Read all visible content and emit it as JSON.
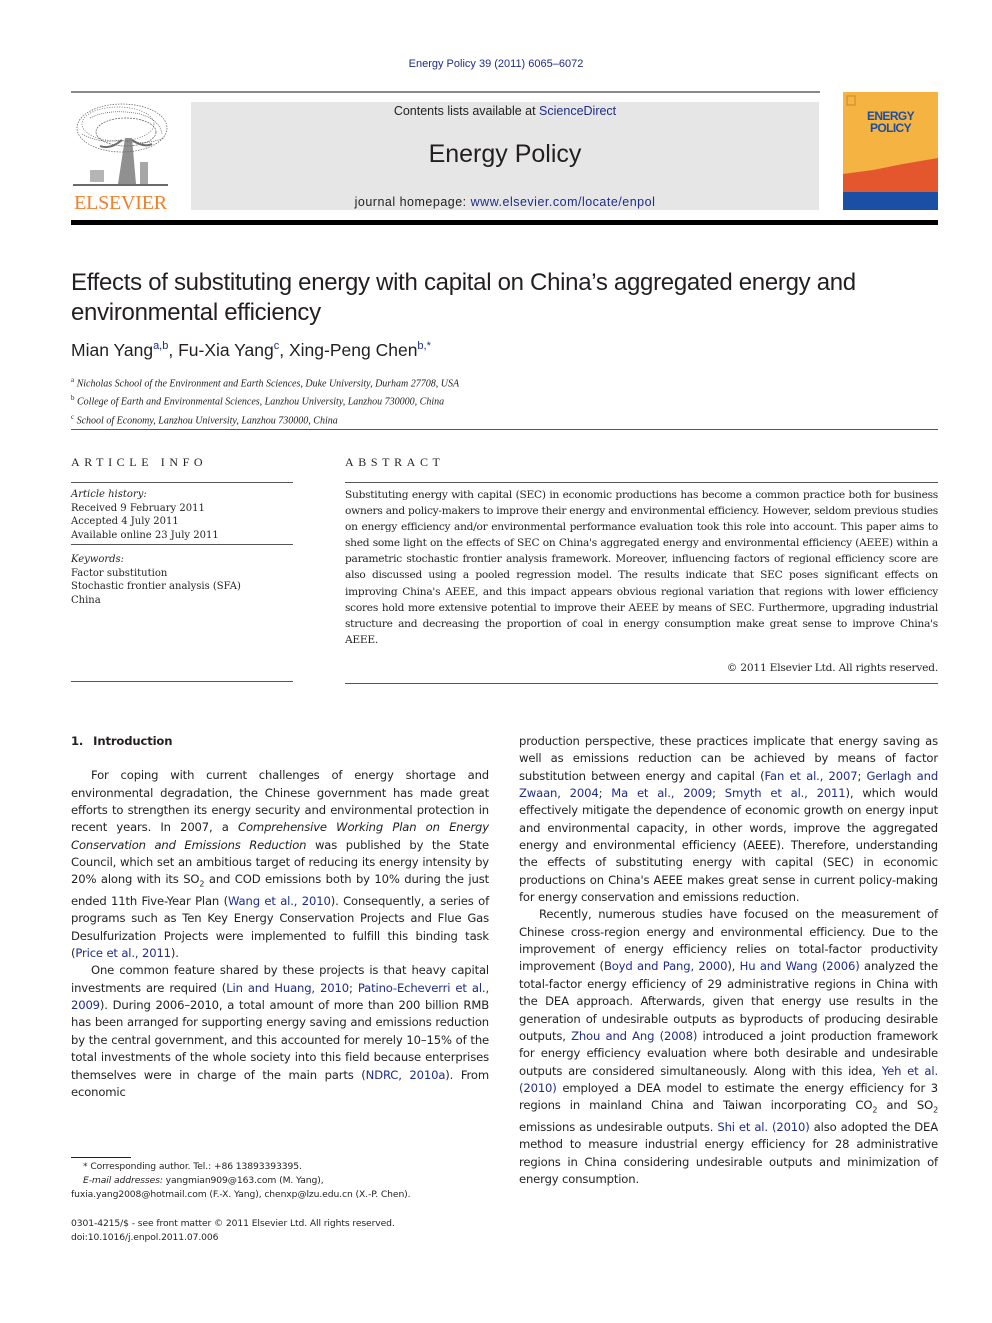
{
  "header": {
    "citation": "Energy Policy 39 (2011) 6065–6072",
    "contents_prefix": "Contents lists available at ",
    "contents_link": "ScienceDirect",
    "journal_name": "Energy Policy",
    "homepage_prefix": "journal homepage: ",
    "homepage_link": "www.elsevier.com/locate/enpol",
    "publisher_logo": "ELSEVIER",
    "cover_title_line1": "ENERGY",
    "cover_title_line2": "POLICY",
    "colors": {
      "link": "#1f2d86",
      "elsevier_orange": "#f0802b",
      "masthead_gray": "#e6e6e6",
      "cover_yellow": "#f5b342",
      "cover_orange": "#e4572e",
      "cover_blue": "#1b4fa6"
    }
  },
  "article": {
    "title": "Effects of substituting energy with capital on China’s aggregated energy and environmental efficiency",
    "authors": [
      {
        "name": "Mian Yang",
        "sup": "a,b"
      },
      {
        "name": "Fu-Xia Yang",
        "sup": "c"
      },
      {
        "name": "Xing-Peng Chen",
        "sup": "b,*"
      }
    ],
    "affiliations": [
      {
        "mark": "a",
        "text": "Nicholas School of the Environment and Earth Sciences, Duke University, Durham 27708, USA"
      },
      {
        "mark": "b",
        "text": "College of Earth and Environmental Sciences, Lanzhou University, Lanzhou 730000, China"
      },
      {
        "mark": "c",
        "text": "School of Economy, Lanzhou University, Lanzhou 730000, China"
      }
    ]
  },
  "article_info": {
    "heading": "ARTICLE INFO",
    "history_label": "Article history:",
    "history": [
      "Received 9 February 2011",
      "Accepted 4 July 2011",
      "Available online 23 July 2011"
    ],
    "keywords_label": "Keywords:",
    "keywords": [
      "Factor substitution",
      "Stochastic frontier analysis (SFA)",
      "China"
    ]
  },
  "abstract": {
    "heading": "ABSTRACT",
    "text": "Substituting energy with capital (SEC) in economic productions has become a common practice both for business owners and policy-makers to improve their energy and environmental efficiency. However, seldom previous studies on energy efficiency and/or environmental performance evaluation took this role into account. This paper aims to shed some light on the effects of SEC on China's aggregated energy and environmental efficiency (AEEE) within a parametric stochastic frontier analysis framework. Moreover, influencing factors of regional efficiency score are also discussed using a pooled regression model. The results indicate that SEC poses significant effects on improving China's AEEE, and this impact appears obvious regional variation that regions with lower efficiency scores hold more extensive potential to improve their AEEE by means of SEC. Furthermore, upgrading industrial structure and decreasing the proportion of coal in energy consumption make great sense to improve China's AEEE.",
    "copyright": "© 2011 Elsevier Ltd. All rights reserved."
  },
  "body": {
    "section_number": "1.",
    "section_title": "Introduction",
    "p1": {
      "t1": "For coping with current challenges of energy shortage and environmental degradation, the Chinese government has made great efforts to strengthen its energy security and environmental protection in recent years. In 2007, a ",
      "italic": "Comprehensive Working Plan on Energy Conservation and Emissions Reduction",
      "t2": " was published by the State Council, which set an ambitious target of reducing its energy intensity by 20% along with its SO",
      "sub1": "2",
      "t3": " and COD emissions both by 10% during the just ended 11th Five-Year Plan (",
      "ref1": "Wang et al., 2010",
      "t4": "). Consequently, a series of programs such as Ten Key Energy Conservation Projects and Flue Gas Desulfurization Projects were implemented to fulfill this binding task (",
      "ref2": "Price et al., 2011",
      "t5": ")."
    },
    "p2": {
      "t1": "One common feature shared by these projects is that heavy capital investments are required (",
      "ref1": "Lin and Huang, 2010",
      "sep": "; ",
      "ref2": "Patino-Echeverri et al., 2009",
      "t2": "). During 2006–2010, a total amount of more than 200 billion RMB has been arranged for supporting energy saving and emissions reduction by the central government, and this accounted for merely 10–15% of the total investments of the whole society into this field because enterprises themselves were in charge of the main parts (",
      "ref3": "NDRC, 2010a",
      "t3": "). From economic production perspective, these practices implicate that energy saving as well as emissions reduction can be achieved by means of factor substitution between energy and capital (",
      "ref4": "Fan et al., 2007",
      "sep2": "; ",
      "ref5": "Gerlagh and Zwaan, 2004",
      "sep3": "; ",
      "ref6": "Ma et al., 2009",
      "sep4": "; ",
      "ref7": "Smyth et al., 2011",
      "t4": "), which would effectively mitigate the dependence of economic growth on energy input and environmental capacity, in other words, improve the aggregated energy and environmental efficiency (AEEE). Therefore, understanding the effects of substituting energy with capital (SEC) in economic productions on China's AEEE makes great sense in current policy-making for energy conservation and emissions reduction."
    },
    "p3": {
      "t1": "Recently, numerous studies have focused on the measurement of Chinese cross-region energy and environmental efficiency. Due to the improvement of energy efficiency relies on total-factor productivity improvement (",
      "ref1": "Boyd and Pang, 2000",
      "t2": "), ",
      "ref2": "Hu and Wang (2006)",
      "t3": " analyzed the total-factor energy efficiency of 29 administrative regions in China with the DEA approach. Afterwards, given that energy use results in the generation of undesirable outputs as byproducts of producing desirable outputs, ",
      "ref3": "Zhou and Ang (2008)",
      "t4": " introduced a joint production framework for energy efficiency evaluation where both desirable and undesirable outputs are considered simultaneously. Along with this idea, ",
      "ref4": "Yeh et al. (2010)",
      "t5": " employed a DEA model to estimate the energy efficiency for 3 regions in mainland China and Taiwan incorporating CO",
      "sub1": "2",
      "t6": " and SO",
      "sub2": "2",
      "t7": " emissions as undesirable outputs. ",
      "ref5": "Shi et al. (2010)",
      "t8": " also adopted the DEA method to measure industrial energy efficiency for 28 administrative regions in China considering undesirable outputs and minimization of energy consumption."
    }
  },
  "footnotes": {
    "corresponding": "* Corresponding author. Tel.: +86 13893393395.",
    "email_label": "E-mail addresses:",
    "email1": " yangmian909@163.com (M. Yang),",
    "email2": "fuxia.yang2008@hotmail.com (F.-X. Yang), chenxp@lzu.edu.cn (X.-P. Chen).",
    "frontmatter": "0301-4215/$ - see front matter © 2011 Elsevier Ltd. All rights reserved.",
    "doi": "doi:10.1016/j.enpol.2011.07.006"
  }
}
